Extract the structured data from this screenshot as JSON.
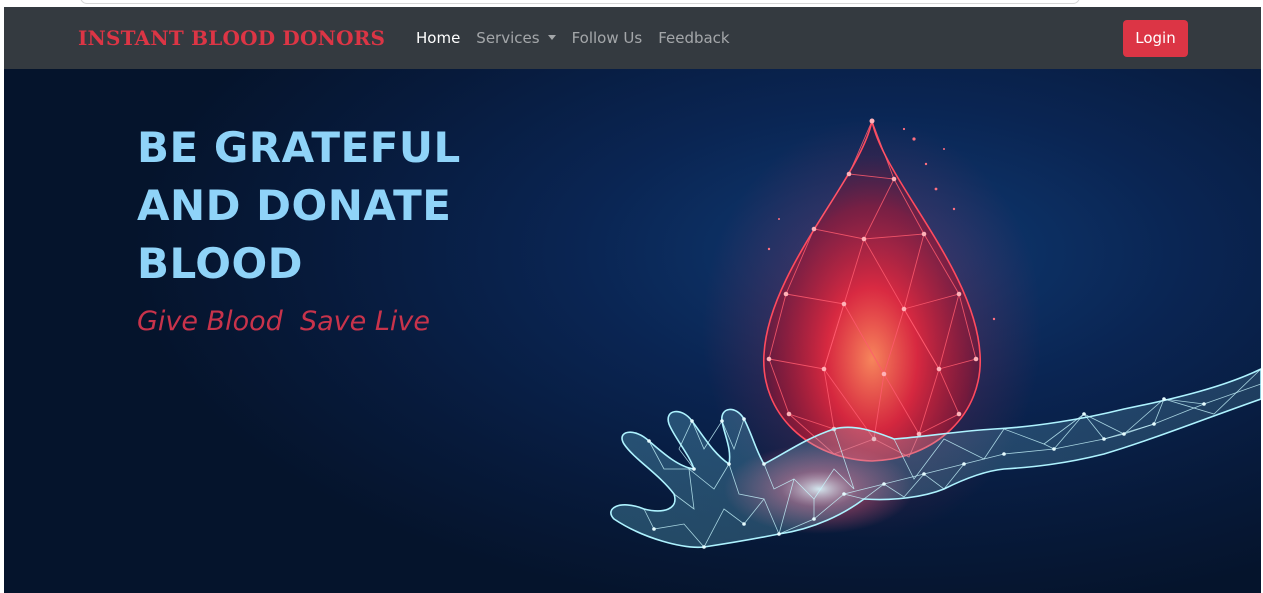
{
  "brand": {
    "name": "INSTANT BLOOD DONORS"
  },
  "nav": {
    "items": [
      {
        "label": "Home",
        "active": true
      },
      {
        "label": "Services",
        "dropdown": true
      },
      {
        "label": "Follow Us"
      },
      {
        "label": "Feedback"
      }
    ],
    "login_label": "Login"
  },
  "hero": {
    "title_lines": [
      "BE GRATEFUL",
      "AND DONATE",
      "BLOOD"
    ],
    "tagline": "Give Blood  Save Live"
  },
  "colors": {
    "brand_red": "#dc3545",
    "navbar_bg": "#343a40",
    "hero_bg": "#0a2553",
    "title_blue": "#8fd3f8",
    "tagline_red": "#c8334b"
  },
  "icons": [
    "caret-down-icon",
    "blood-drop-illustration",
    "wireframe-hand-illustration"
  ]
}
